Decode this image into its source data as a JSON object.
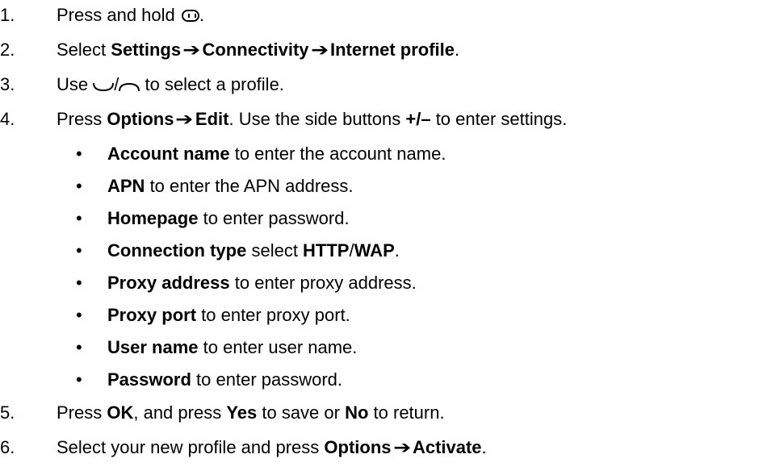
{
  "steps": [
    {
      "num": "1.",
      "parts": [
        "Press and hold ",
        "."
      ],
      "icon": "menu-key-icon"
    },
    {
      "num": "2.",
      "pre": "Select ",
      "b1": "Settings",
      "b2": "Connectivity",
      "b3": "Internet profile",
      "post": "."
    },
    {
      "num": "3.",
      "pre": "Use ",
      "sep": "/",
      "post": " to select a profile.",
      "icons": [
        "left-softkey-icon",
        "right-softkey-icon"
      ]
    },
    {
      "num": "4.",
      "pre": "Press ",
      "b1": "Options",
      "b2": "Edit",
      "mid": ". Use the side buttons ",
      "b3": "+/–",
      "post": " to enter settings."
    },
    {
      "num": "5.",
      "pre": "Press ",
      "b1": "OK",
      "mid1": ", and press ",
      "b2": "Yes",
      "mid2": " to save or ",
      "b3": "No",
      "post": " to return."
    },
    {
      "num": "6.",
      "pre": "Select your new profile and press ",
      "b1": "Options",
      "b2": "Activate",
      "post": "."
    }
  ],
  "settings": [
    {
      "bullet": "•",
      "label": "Account name",
      "desc": " to enter the account name."
    },
    {
      "bullet": "•",
      "label": "APN",
      "desc": " to enter the APN address."
    },
    {
      "bullet": "•",
      "label": "Homepage",
      "desc": " to enter password."
    },
    {
      "bullet": "•",
      "label": "Connection type",
      "desc": " select ",
      "label2": "HTTP",
      "sep": "/",
      "label3": "WAP",
      "desc2": "."
    },
    {
      "bullet": "•",
      "label": "Proxy address",
      "desc": " to enter proxy address."
    },
    {
      "bullet": "•",
      "label": "Proxy port",
      "desc": " to enter proxy port."
    },
    {
      "bullet": "•",
      "label": "User name",
      "desc": " to enter user name."
    },
    {
      "bullet": "•",
      "label": "Password",
      "desc": " to enter password."
    }
  ],
  "arrow": "➔"
}
